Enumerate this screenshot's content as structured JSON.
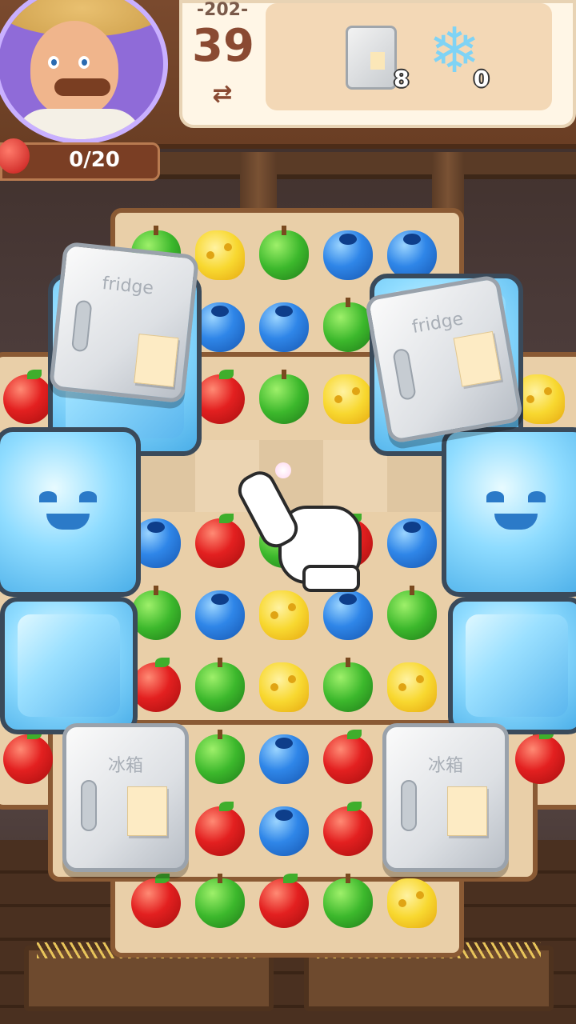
{
  "hud": {
    "level_label": "-202-",
    "moves_left": "39",
    "swap_symbol": "⇄",
    "collect_progress": "0/20",
    "collect_target_icon": "apple-icon",
    "goals": [
      {
        "icon": "fridge-icon",
        "count": "8"
      },
      {
        "icon": "snowflake-icon",
        "count": "0"
      }
    ]
  },
  "board": {
    "fridge_label_en": "fridge",
    "fridge_label_cn": "冰箱",
    "tutorial_hint_icon": "pointing-hand-icon"
  },
  "colors": {
    "apple": "#e32020",
    "pear": "#3cb82c",
    "blueberry": "#2f86e8",
    "cheese": "#f8d830",
    "ice": "#8fdcff"
  }
}
